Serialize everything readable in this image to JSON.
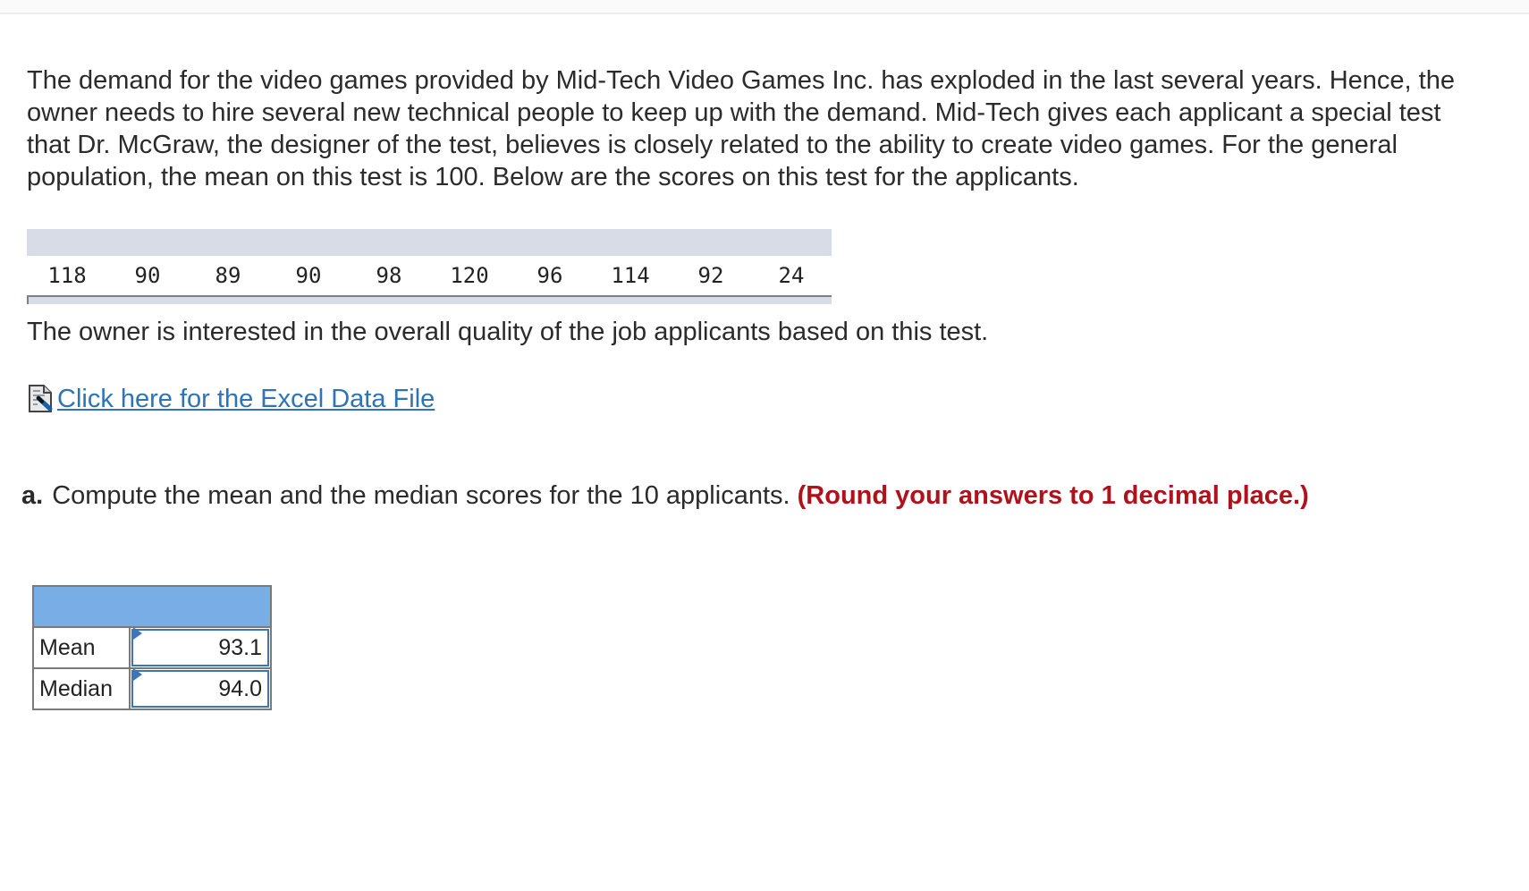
{
  "intro": {
    "lines": [
      "The demand for the video games provided by Mid-Tech Video Games Inc. has exploded in the last several years. Hence, the",
      "owner needs to hire several new technical people to keep up with the demand. Mid-Tech gives each applicant a special test",
      "that Dr. McGraw, the designer of the test, believes is closely related to the ability to create video games. For the general",
      "population, the mean on this test is 100. Below are the scores on this test for the applicants."
    ]
  },
  "scores": [
    "118",
    "90",
    "89",
    "90",
    "98",
    "120",
    "96",
    "114",
    "92",
    "24"
  ],
  "owner_text": "The owner is interested in the overall quality of the job applicants based on this test.",
  "excel_link": {
    "icon": "excel-file-icon",
    "label": "Click here for the Excel Data File"
  },
  "question": {
    "part": "a.",
    "text": "Compute the mean and the median scores for the 10 applicants.",
    "note": "(Round your answers to 1 decimal place.)"
  },
  "answers": [
    {
      "label": "Mean",
      "value": "93.1"
    },
    {
      "label": "Median",
      "value": "94.0"
    }
  ],
  "colors": {
    "link": "#2e74b5",
    "note": "#b0121b",
    "answer_header": "#78ade6",
    "data_header": "#d8dce6",
    "input_border": "#3e75b8"
  }
}
